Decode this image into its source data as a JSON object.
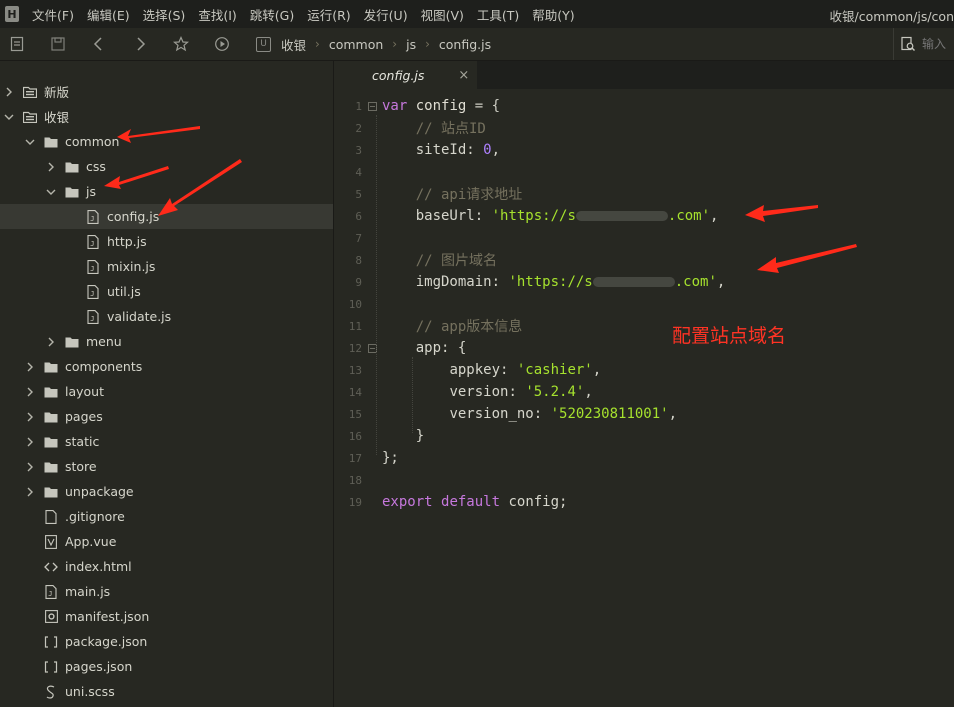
{
  "menubar": {
    "items": [
      "文件(F)",
      "编辑(E)",
      "选择(S)",
      "查找(I)",
      "跳转(G)",
      "运行(R)",
      "发行(U)",
      "视图(V)",
      "工具(T)",
      "帮助(Y)"
    ],
    "window_title": "收银/common/js/con"
  },
  "toolbar": {
    "breadcrumb": [
      "收银",
      "common",
      "js",
      "config.js"
    ],
    "search_placeholder": "输入"
  },
  "sidebar": {
    "rows": [
      {
        "label": "新版",
        "icon": "folder-project-icon",
        "expanded": false
      },
      {
        "label": "收银",
        "icon": "folder-project-icon",
        "expanded": true
      },
      {
        "label": "common",
        "icon": "folder-icon",
        "expanded": true
      },
      {
        "label": "css",
        "icon": "folder-icon",
        "expanded": false
      },
      {
        "label": "js",
        "icon": "folder-icon",
        "expanded": true
      },
      {
        "label": "config.js",
        "icon": "js-file-icon",
        "selected": true
      },
      {
        "label": "http.js",
        "icon": "js-file-icon"
      },
      {
        "label": "mixin.js",
        "icon": "js-file-icon"
      },
      {
        "label": "util.js",
        "icon": "js-file-icon"
      },
      {
        "label": "validate.js",
        "icon": "js-file-icon"
      },
      {
        "label": "menu",
        "icon": "folder-icon",
        "expanded": false
      },
      {
        "label": "components",
        "icon": "folder-icon",
        "expanded": false
      },
      {
        "label": "layout",
        "icon": "folder-icon",
        "expanded": false
      },
      {
        "label": "pages",
        "icon": "folder-icon",
        "expanded": false
      },
      {
        "label": "static",
        "icon": "folder-icon",
        "expanded": false
      },
      {
        "label": "store",
        "icon": "folder-icon",
        "expanded": false
      },
      {
        "label": "unpackage",
        "icon": "folder-icon",
        "expanded": false
      },
      {
        "label": ".gitignore",
        "icon": "file-icon"
      },
      {
        "label": "App.vue",
        "icon": "vue-file-icon"
      },
      {
        "label": "index.html",
        "icon": "html-file-icon"
      },
      {
        "label": "main.js",
        "icon": "js-file-icon"
      },
      {
        "label": "manifest.json",
        "icon": "settings-file-icon"
      },
      {
        "label": "package.json",
        "icon": "json-file-icon"
      },
      {
        "label": "pages.json",
        "icon": "json-file-icon"
      },
      {
        "label": "uni.scss",
        "icon": "scss-file-icon"
      }
    ]
  },
  "editor": {
    "tab_label": "config.js",
    "tab_close": "×",
    "lines": [
      "var config = {",
      "    // 站点ID",
      "    siteId: 0,",
      "",
      "    // api请求地址",
      "    baseUrl: 'https://s",
      "",
      "    // 图片域名",
      "    imgDomain: 'https://s",
      "",
      "    // app版本信息",
      "    app: {",
      "        appkey: 'cashier',",
      "        version: '5.2.4',",
      "        version_no: '520230811001',",
      "    }",
      "};",
      "",
      "export default config;"
    ],
    "code": {
      "l1_kw": "var",
      "l1_name": "config",
      "l1_rest": " = {",
      "l2_cmt": "// 站点ID",
      "l3_key": "siteId",
      "l3_num": "0",
      "l5_cmt": "// api请求地址",
      "l6_key": "baseUrl",
      "l6_str_a": "'https://s",
      "l6_str_b": ".com'",
      "l8_cmt": "// 图片域名",
      "l9_key": "imgDomain",
      "l9_str_a": "'https://s",
      "l9_str_b": ".com'",
      "l11_cmt": "// app版本信息",
      "l12_key": "app",
      "l13_key": "appkey",
      "l13_str": "'cashier'",
      "l14_key": "version",
      "l14_str": "'5.2.4'",
      "l15_key": "version_no",
      "l15_str": "'520230811001'",
      "l16": "}",
      "l17": "};",
      "l19_kw1": "export",
      "l19_kw2": "default",
      "l19_rest": " config;"
    }
  },
  "annotation": {
    "text": "配置站点域名",
    "color": "#ff3324"
  },
  "colors": {
    "background": "#272822",
    "menubar": "#1e1f1c",
    "selected_row": "#383933",
    "string": "#a6e22e",
    "keyword": "#c678dd",
    "number": "#ae81ff",
    "comment": "#75715e"
  }
}
